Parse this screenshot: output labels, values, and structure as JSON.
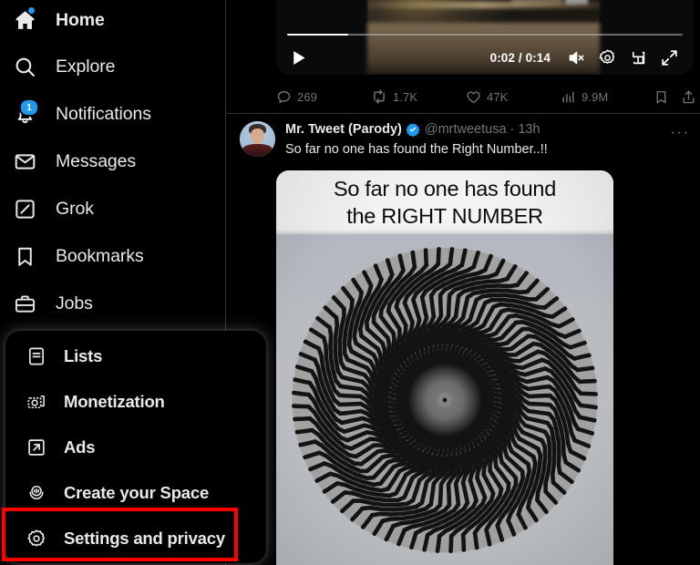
{
  "sidebar": {
    "items": [
      {
        "label": "Home",
        "icon": "home-icon",
        "bold": true,
        "badge_dot": true
      },
      {
        "label": "Explore",
        "icon": "search-icon",
        "bold": false
      },
      {
        "label": "Notifications",
        "icon": "bell-icon",
        "bold": false,
        "badge_count": "1"
      },
      {
        "label": "Messages",
        "icon": "envelope-icon",
        "bold": false
      },
      {
        "label": "Grok",
        "icon": "grok-icon",
        "bold": false
      },
      {
        "label": "Bookmarks",
        "icon": "bookmark-icon",
        "bold": false
      },
      {
        "label": "Jobs",
        "icon": "briefcase-icon",
        "bold": false
      }
    ]
  },
  "dropdown": {
    "items": [
      {
        "label": "Lists",
        "icon": "list-icon"
      },
      {
        "label": "Monetization",
        "icon": "money-icon"
      },
      {
        "label": "Ads",
        "icon": "arrow-out-box-icon"
      },
      {
        "label": "Create your Space",
        "icon": "microphone-icon"
      },
      {
        "label": "Settings and privacy",
        "icon": "gear-icon"
      }
    ],
    "highlighted_item": "Settings and privacy",
    "highlight_color": "#fe0000"
  },
  "video": {
    "current_time": "0:02",
    "duration": "0:14",
    "time_display": "0:02 / 0:14",
    "progress_percent": 15,
    "muted": true,
    "controls": [
      "play-button",
      "mute-button",
      "settings-button",
      "picture-in-picture-button",
      "fullscreen-button"
    ]
  },
  "engagement": {
    "reply_count": "269",
    "retweet_count": "1.7K",
    "like_count": "47K",
    "view_count": "9.9M",
    "bookmark_label": "",
    "share_label": ""
  },
  "tweet": {
    "display_name": "Mr. Tweet (Parody)",
    "verified": true,
    "handle": "@mrtweetusa",
    "separator": "·",
    "timestamp": "13h",
    "body": "So far no one has found the Right Number..!!",
    "more_glyph": "···"
  },
  "meme": {
    "caption_line1": "So far no one has found",
    "caption_line2": "the RIGHT NUMBER",
    "image_description": "spiral-optical-illusion"
  },
  "colors": {
    "accent": "#1d9bf0",
    "background": "#000000",
    "text_primary": "#e7e9ea",
    "text_secondary": "#71767b",
    "border": "#2f3336",
    "highlight": "#fe0000"
  }
}
